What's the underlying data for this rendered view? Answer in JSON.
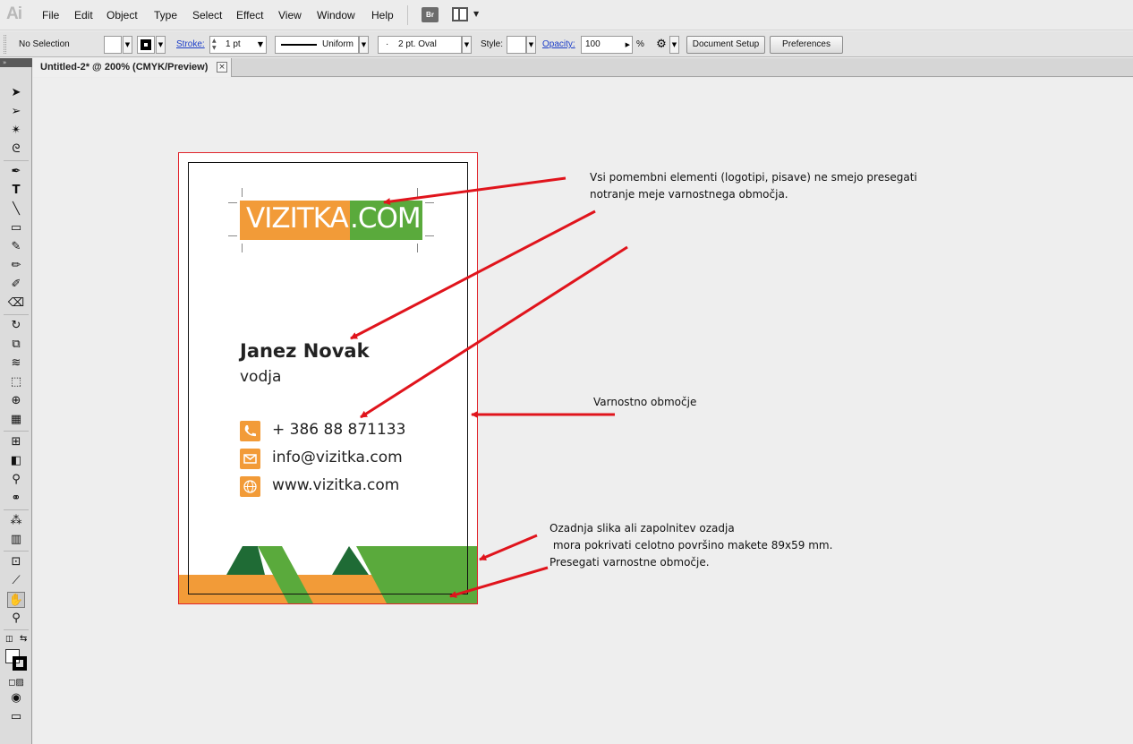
{
  "app": {
    "logo": "Ai"
  },
  "menu": [
    "File",
    "Edit",
    "Object",
    "Type",
    "Select",
    "Effect",
    "View",
    "Window",
    "Help"
  ],
  "menubar_buttons": {
    "bridge": "Br"
  },
  "controlbar": {
    "selection": "No Selection",
    "stroke_label": "Stroke:",
    "stroke_weight": "1 pt",
    "stroke_profile": "Uniform",
    "brush": "2 pt. Oval",
    "style_label": "Style:",
    "opacity_label": "Opacity:",
    "opacity_value": "100",
    "opacity_unit": "%",
    "document_setup": "Document Setup",
    "preferences": "Preferences"
  },
  "document": {
    "tab_title": "Untitled-2* @ 200% (CMYK/Preview)",
    "close": "×"
  },
  "card": {
    "logo_part1": "VIZITKA",
    "logo_part2": ".COM",
    "name": "Janez Novak",
    "role": "vodja",
    "phone": "+ 386 88 871133",
    "email": "info@vizitka.com",
    "web": "www.vizitka.com"
  },
  "colors": {
    "orange": "#f29b38",
    "green": "#5aaa3c",
    "dark_green": "#1f6b35",
    "bleed_line": "#e0242c",
    "arrow": "#e0141c"
  },
  "annotations": {
    "note1": "Vsi pomembni elementi (logotipi, pisave) ne smejo presegati\nnotranje meje varnostnega območja.",
    "note2": "Varnostno območje",
    "note3": "Ozadnja slika ali zapolnitev ozadja\n mora pokrivati celotno površino makete 89x59 mm.\nPresegati varnostne območje."
  }
}
